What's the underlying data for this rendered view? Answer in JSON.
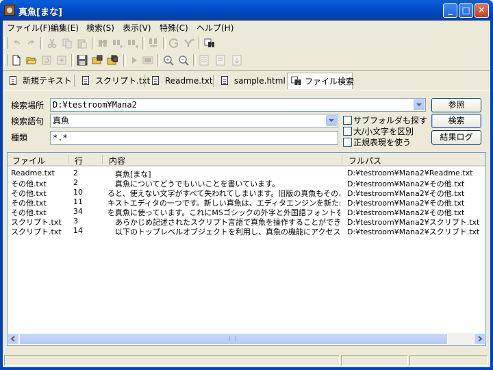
{
  "window": {
    "title": "真魚[まな]"
  },
  "menu": [
    {
      "label": "ファイル(F)"
    },
    {
      "label": "編集(E)"
    },
    {
      "label": "検索(S)"
    },
    {
      "label": "表示(V)"
    },
    {
      "label": "特殊(C)"
    },
    {
      "label": "ヘルプ(H)"
    }
  ],
  "tabs": [
    {
      "label": "新規テキスト"
    },
    {
      "label": "スクリプト.txt"
    },
    {
      "label": "Readme.txt"
    },
    {
      "label": "sample.html"
    },
    {
      "label": "ファイル検索"
    }
  ],
  "search": {
    "location_label": "検索場所",
    "location_value": "D:¥testroom¥Mana2",
    "term_label": "検索語句",
    "term_value": "真魚",
    "type_label": "種類",
    "type_value": "*.*",
    "browse_button": "参照",
    "search_button": "検索",
    "log_button": "結果ログ",
    "subfolder_label": "サブフォルダも探す",
    "case_label": "大/小文字を区別",
    "regex_label": "正規表現を使う",
    "subfolder_checked": false,
    "case_checked": false,
    "regex_checked": false
  },
  "results": {
    "columns": [
      "ファイル",
      "行",
      "内容",
      "フルパス"
    ],
    "rows": [
      {
        "file": "Readme.txt",
        "line": "2",
        "content": "　真魚[まな]",
        "path": "D:¥testroom¥Mana2¥Readme.txt"
      },
      {
        "file": "その他.txt",
        "line": "2",
        "content": "　真魚についてどうでもいいことを書いています。",
        "path": "D:¥testroom¥Mana2¥その他.txt"
      },
      {
        "file": "その他.txt",
        "line": "10",
        "content": "ると、使えない文字がすべて失われてしまいます。旧版の真魚もそのよ…",
        "path": "D:¥testroom¥Mana2¥その他.txt"
      },
      {
        "file": "その他.txt",
        "line": "11",
        "content": "キストエディタの一つです。新しい真魚は、エディタエンジンを新たに作…",
        "path": "D:¥testroom¥Mana2¥その他.txt"
      },
      {
        "file": "その他.txt",
        "line": "34",
        "content": "を真魚に使っています。これにMSゴシックの外字と外国語フォントを混ぜ…",
        "path": "D:¥testroom¥Mana2¥その他.txt"
      },
      {
        "file": "スクリプト.txt",
        "line": "3",
        "content": "　あらかじめ記述されたスクリプト言語で真魚を操作することができます。",
        "path": "D:¥testroom¥Mana2¥スクリプト.txt"
      },
      {
        "file": "スクリプト.txt",
        "line": "14",
        "content": "　以下のトップレベルオブジェクトを利用し、真魚の機能にアクセス出来…",
        "path": "D:¥testroom¥Mana2¥スクリプト.txt"
      }
    ]
  }
}
